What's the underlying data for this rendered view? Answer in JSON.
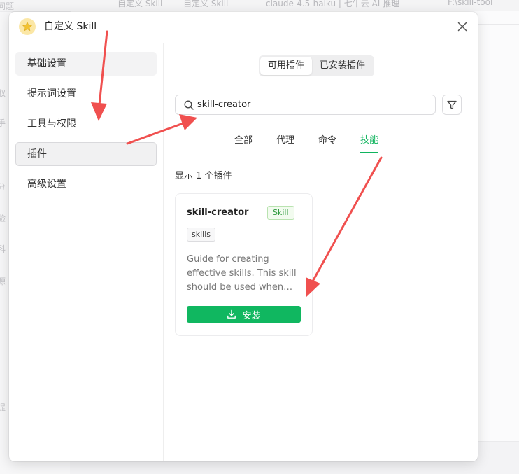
{
  "background": {
    "breadcrumbs": [
      "自定义 Skill",
      "自定义 Skill",
      "claude-4.5-haiku | 七牛云 AI 推理",
      "F:\\skill-tool"
    ],
    "side_fragments": [
      "问题",
      "取",
      "手",
      "分",
      "验",
      "科",
      "源",
      "提"
    ]
  },
  "dialog": {
    "title": "自定义 Skill",
    "logo_icon": "star-icon",
    "close_icon": "close-icon"
  },
  "sidebar": {
    "items": [
      {
        "label": "基础设置",
        "state": "hover"
      },
      {
        "label": "提示词设置",
        "state": "normal"
      },
      {
        "label": "工具与权限",
        "state": "normal"
      },
      {
        "label": "插件",
        "state": "active"
      },
      {
        "label": "高级设置",
        "state": "normal"
      }
    ]
  },
  "content": {
    "segments": [
      {
        "label": "可用插件",
        "active": true
      },
      {
        "label": "已安装插件",
        "active": false
      }
    ],
    "search": {
      "value": "skill-creator",
      "placeholder": ""
    },
    "filter_tabs": [
      {
        "label": "全部",
        "active": false
      },
      {
        "label": "代理",
        "active": false
      },
      {
        "label": "命令",
        "active": false
      },
      {
        "label": "技能",
        "active": true
      }
    ],
    "result_count_text": "显示 1 个插件",
    "cards": [
      {
        "title": "skill-creator",
        "type_badge": "Skill",
        "tags": [
          "skills"
        ],
        "description": "Guide for creating effective skills. This skill should be used when…",
        "install_label": "安装"
      }
    ]
  },
  "colors": {
    "accent_green": "#10b760",
    "annotation_red": "#f0504f",
    "logo_yellow": "#f2c230"
  }
}
